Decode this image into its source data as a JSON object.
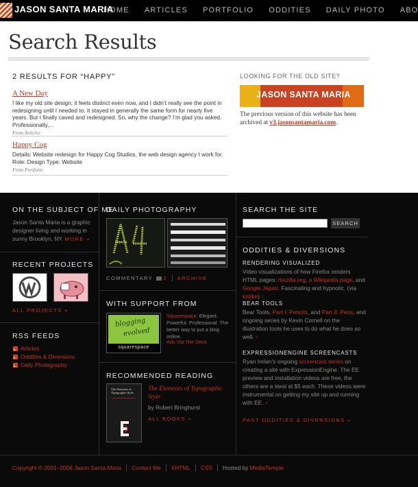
{
  "nav": {
    "brand": "JASON SANTA MARIA",
    "items": [
      "HOME",
      "ARTICLES",
      "PORTFOLIO",
      "ODDITIES",
      "DAILY PHOTO",
      "ABOUT"
    ]
  },
  "header": {
    "title": "Search Results"
  },
  "results": {
    "heading": "2 RESULTS FOR “HAPPY”",
    "items": [
      {
        "title": "A New Day",
        "text": "I like my old site design; it feels distinct even now, and I didn’t really see the point in redesigning until I needed to. It stayed in generally the same form for nearly five years. But I finally caved and redesigned. So, why the change? I’m glad you asked. Professionally,...",
        "source": "From Articles"
      },
      {
        "title": "Happy Cog",
        "text": "Details: Website redesign for Happy Cog Studios, the web design agency I work for. Role: Design Type: Website",
        "source": "From Portfolio"
      }
    ]
  },
  "oldsite": {
    "heading": "LOOKING FOR THE OLD SITE?",
    "banner": "JASON SANTA MARIA",
    "text_before": "The previous version of this website has been archived at ",
    "link": "v3.jasonsantamaria.com",
    "text_after": "."
  },
  "footer": {
    "about": {
      "heading": "ON THE SUBJECT OF ME",
      "text": "Jason Santa Maria is a graphic designer living and working in sunny Brooklyn, NY.",
      "more": "MORE »"
    },
    "projects": {
      "heading": "RECENT PROJECTS",
      "all": "ALL PROJECTS »"
    },
    "rss": {
      "heading": "RSS FEEDS",
      "items": [
        "Articles",
        "Oddities & Diversions",
        "Daily Photography"
      ]
    },
    "photo": {
      "heading": "DAILY PHOTOGRAPHY",
      "commentary": "COMMENTARY",
      "count": "2",
      "archive": "ARCHIVE"
    },
    "support": {
      "heading": "WITH SUPPORT FROM",
      "sponsor": "Squarespace",
      "text": ". Elegant. Powerful. Professional. The better way to put a blog online.",
      "ads": "Ads Via The Deck",
      "thumb_text_1": "blogging",
      "thumb_text_2": "evolved",
      "thumb_logo": "squarespace"
    },
    "reading": {
      "heading": "RECOMMENDED READING",
      "book": "The Elements of Typographic Style",
      "author": "by Robert Bringhurst",
      "all": "ALL BOOKS »",
      "cover_title": "The Elements of Typographic Style"
    },
    "search": {
      "heading": "SEARCH THE SITE",
      "button": "SEARCH"
    },
    "oddities": {
      "heading": "ODDITIES & DIVERSIONS",
      "past": "PAST ODDITIES & DIVERSIONS »",
      "items": [
        {
          "title": "RENDERING VISUALIZED",
          "t1": "Video visualizations of how Firefox renders HTML pages: ",
          "l1": "mozilla.org",
          "t2": ", ",
          "l2": "a Wikipedia page",
          "t3": ", and ",
          "l3": "Google Japan",
          "t4": ". Fascinating and hypnotic. (via ",
          "l4": "kottke",
          "t5": ")"
        },
        {
          "title": "BEAR TOOLS",
          "t1": "Bear Tools, ",
          "l1": "Part I: Pencils",
          "t2": ", and ",
          "l2": "Part II: Pens",
          "t3": ", and ongoing series by Kevin Cornell on the illustration tools he uses to do what he does so well."
        },
        {
          "title": "EXPRESSIONENGINE SCREENCASTS",
          "t1": "Ryan Irelan’s ongoing ",
          "l1": "screencast series",
          "t2": " on creating a site with ExpressionEngine. The EE preview and installation videos are free, the others are a steal at $5 each. These videos were instrumental on getting my site up and running with EE."
        }
      ],
      "arrow": "↑"
    },
    "bottom": {
      "copyright": "Copyright © 2001–2008",
      "name": "Jason Santa Maria",
      "contact": "Contact Me",
      "xhtml": "XHTML",
      "css": "CSS",
      "hosted": "Hosted by",
      "host": "MediaTemple"
    }
  },
  "colors": {
    "accent": "#c8331e",
    "dark_bg": "#0a0a0a"
  }
}
